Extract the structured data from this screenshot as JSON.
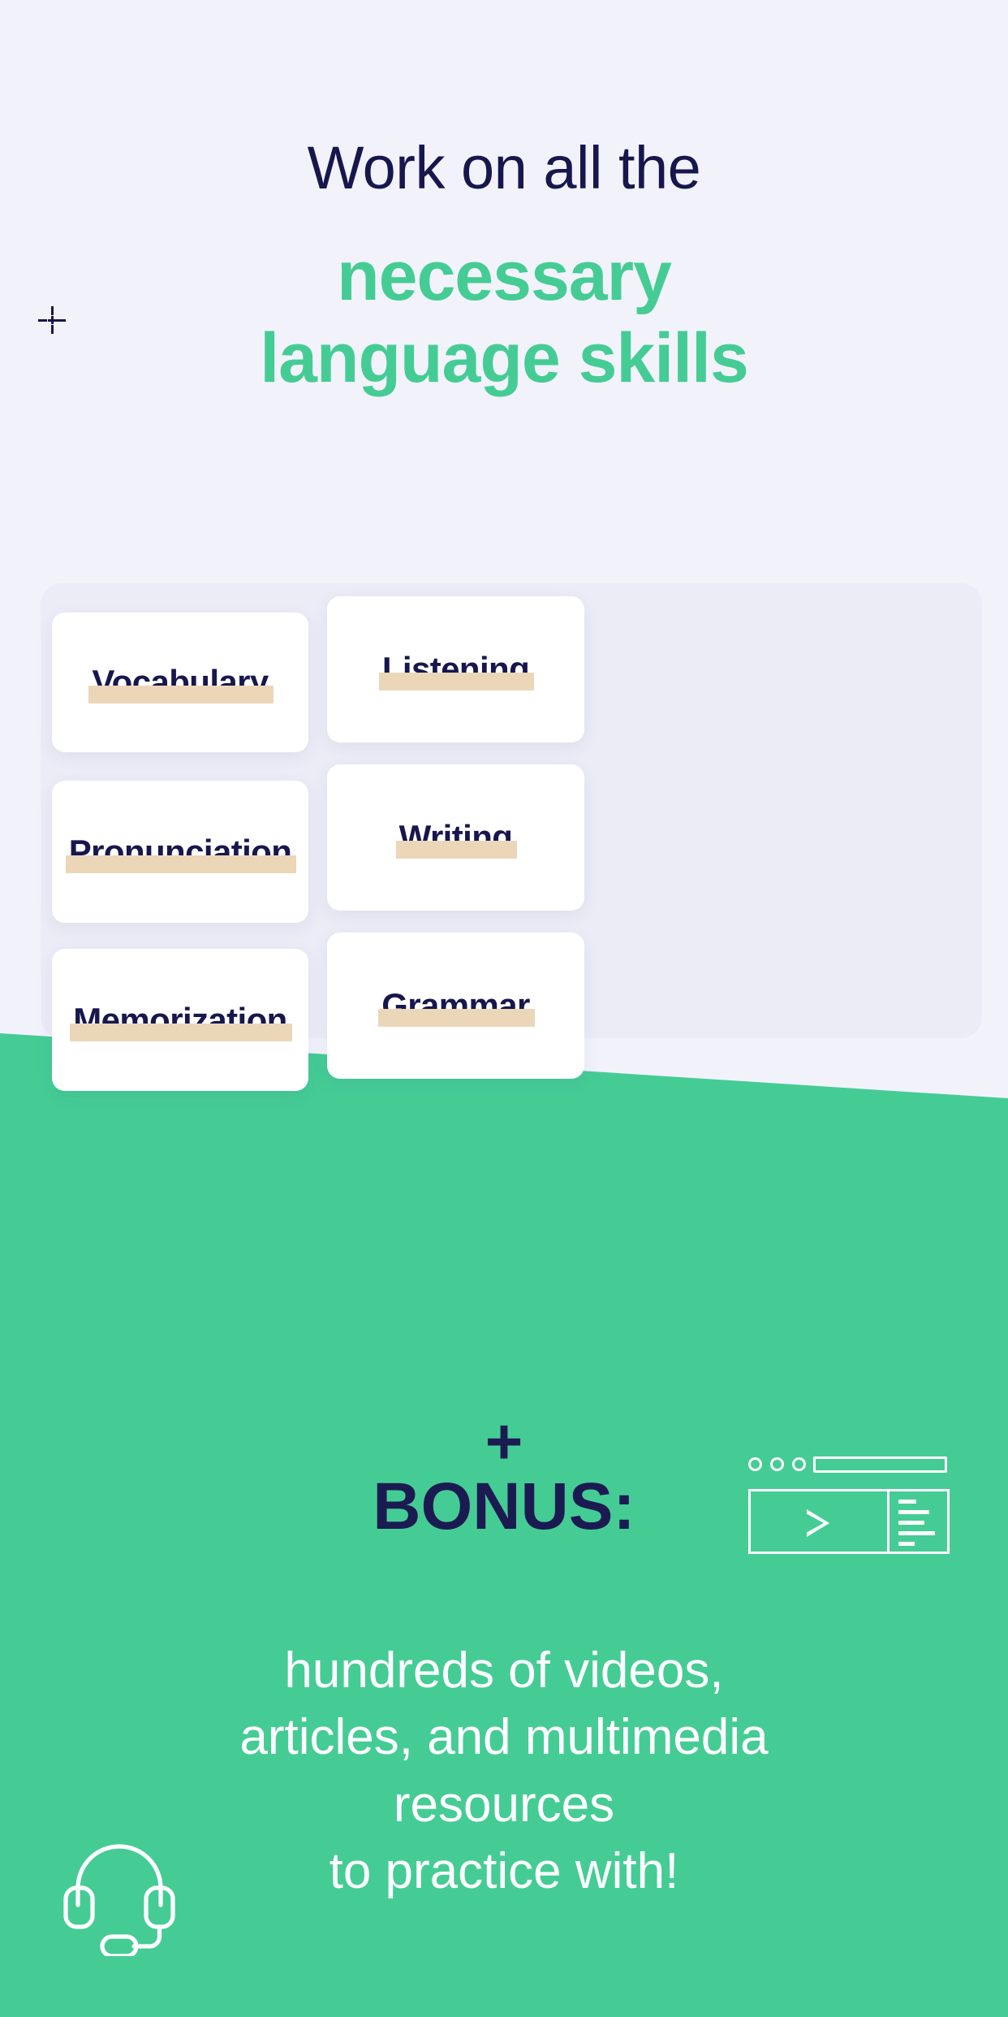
{
  "theme": {
    "bg_light": "#f2f2fb",
    "bg_green": "#45cc95",
    "navy": "#17174d",
    "green_text": "#45cc95",
    "highlight_tan": "#ecd6b8",
    "card_white": "#ffffff"
  },
  "heading": {
    "line1": "Work on all the",
    "line2": "necessary",
    "line3": "language skills"
  },
  "marker": {
    "name": "crosshair-marker"
  },
  "skills": [
    {
      "label": "Vocabulary"
    },
    {
      "label": "Listening"
    },
    {
      "label": "Pronunciation"
    },
    {
      "label": "Writing"
    },
    {
      "label": "Memorization"
    },
    {
      "label": "Grammar"
    }
  ],
  "bonus": {
    "plus": "+",
    "title": "BONUS:",
    "icon": "browser-video-icon"
  },
  "footer": {
    "line1": "hundreds of videos,",
    "line2": "articles, and multimedia",
    "line3": "resources",
    "line4": "to practice with!",
    "icon": "headset-icon"
  }
}
